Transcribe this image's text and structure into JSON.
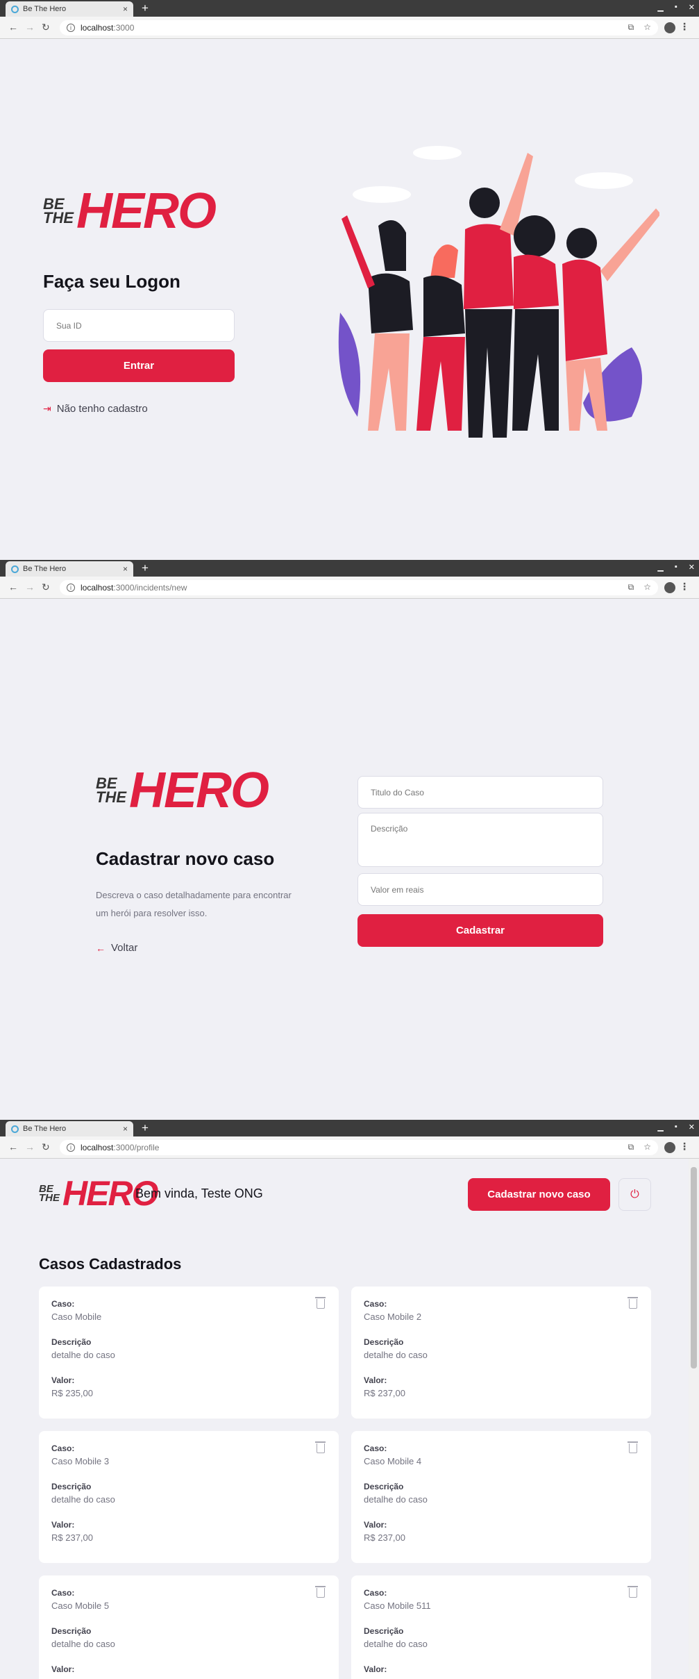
{
  "browser": {
    "tab_title": "Be The Hero",
    "close_glyph": "×",
    "new_tab_glyph": "+",
    "url_host": "localhost",
    "url_paths": [
      ":3000",
      ":3000/incidents/new",
      ":3000/profile"
    ]
  },
  "logo": {
    "be": "BE",
    "the": "THE",
    "hero": "HERO"
  },
  "logon": {
    "title": "Faça seu Logon",
    "id_placeholder": "Sua ID",
    "submit_label": "Entrar",
    "register_link": "Não tenho cadastro"
  },
  "new_incident": {
    "title": "Cadastrar novo caso",
    "description": "Descreva o caso detalhadamente para encontrar um herói para resolver isso.",
    "back_link": "Voltar",
    "title_placeholder": "Titulo do Caso",
    "description_placeholder": "Descrição",
    "value_placeholder": "Valor em reais",
    "submit_label": "Cadastrar"
  },
  "profile": {
    "welcome": "Bem vinda, Teste ONG",
    "new_case_button": "Cadastrar novo caso",
    "section_title": "Casos Cadastrados",
    "labels": {
      "case": "Caso:",
      "description": "Descrição",
      "value": "Valor:"
    },
    "cases": [
      {
        "title": "Caso Mobile",
        "description": "detalhe do caso",
        "value": "R$ 235,00"
      },
      {
        "title": "Caso Mobile 2",
        "description": "detalhe do caso",
        "value": "R$ 237,00"
      },
      {
        "title": "Caso Mobile 3",
        "description": "detalhe do caso",
        "value": "R$ 237,00"
      },
      {
        "title": "Caso Mobile 4",
        "description": "detalhe do caso",
        "value": "R$ 237,00"
      },
      {
        "title": "Caso Mobile 5",
        "description": "detalhe do caso",
        "value": ""
      },
      {
        "title": "Caso Mobile 511",
        "description": "detalhe do caso",
        "value": ""
      }
    ]
  },
  "colors": {
    "primary": "#e02041",
    "background": "#f0f0f5",
    "heading": "#13131a",
    "muted": "#737380"
  },
  "icons": [
    "log-in-icon",
    "arrow-left-icon",
    "power-icon",
    "trash-icon",
    "info-icon",
    "star-icon",
    "translate-icon"
  ]
}
